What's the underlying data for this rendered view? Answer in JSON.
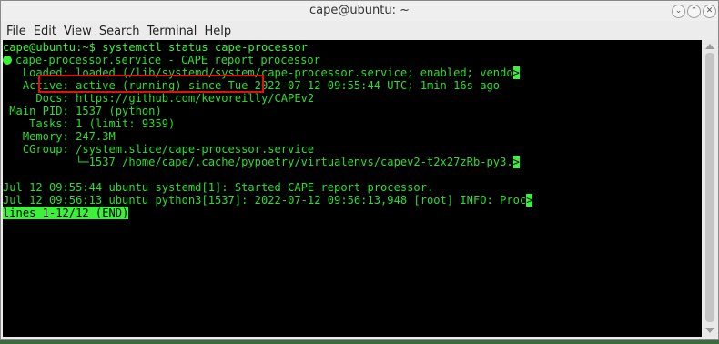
{
  "window": {
    "title": "cape@ubuntu: ~",
    "buttons": {
      "minimize_icon": "chevron-down",
      "maximize_icon": "chevron-up",
      "close_icon": "close"
    }
  },
  "menu": [
    "File",
    "Edit",
    "View",
    "Search",
    "Terminal",
    "Help"
  ],
  "terminal": {
    "prompt": "cape@ubuntu:~$ systemctl status cape-processor",
    "service_line": "cape-processor.service - CAPE report processor",
    "loaded": "   Loaded: loaded (/lib/systemd/system/cape-processor.service; enabled; vendo",
    "active": "   Active: active (running) since Tue 2022-07-12 09:55:44 UTC; 1min 16s ago",
    "docs": "     Docs: https://github.com/kevoreilly/CAPEv2",
    "mainpid": " Main PID: 1537 (python)",
    "tasks": "    Tasks: 1 (limit: 9359)",
    "memory": "   Memory: 247.3M",
    "cgroup": "   CGroup: /system.slice/cape-processor.service",
    "cgroup_child": "           └─1537 /home/cape/.cache/pypoetry/virtualenvs/capev2-t2x27zRb-py3.",
    "log1": "Jul 12 09:55:44 ubuntu systemd[1]: Started CAPE report processor.",
    "log2": "Jul 12 09:56:13 ubuntu python3[1537]: 2022-07-12 09:56:13,948 [root] INFO: Proc",
    "truncation_marker": ">",
    "pager_status": "lines 1-12/12 (END)"
  },
  "colors": {
    "terminal_fg": "#2ddd2d",
    "terminal_bg": "#000000",
    "highlight_box": "#e01010"
  }
}
